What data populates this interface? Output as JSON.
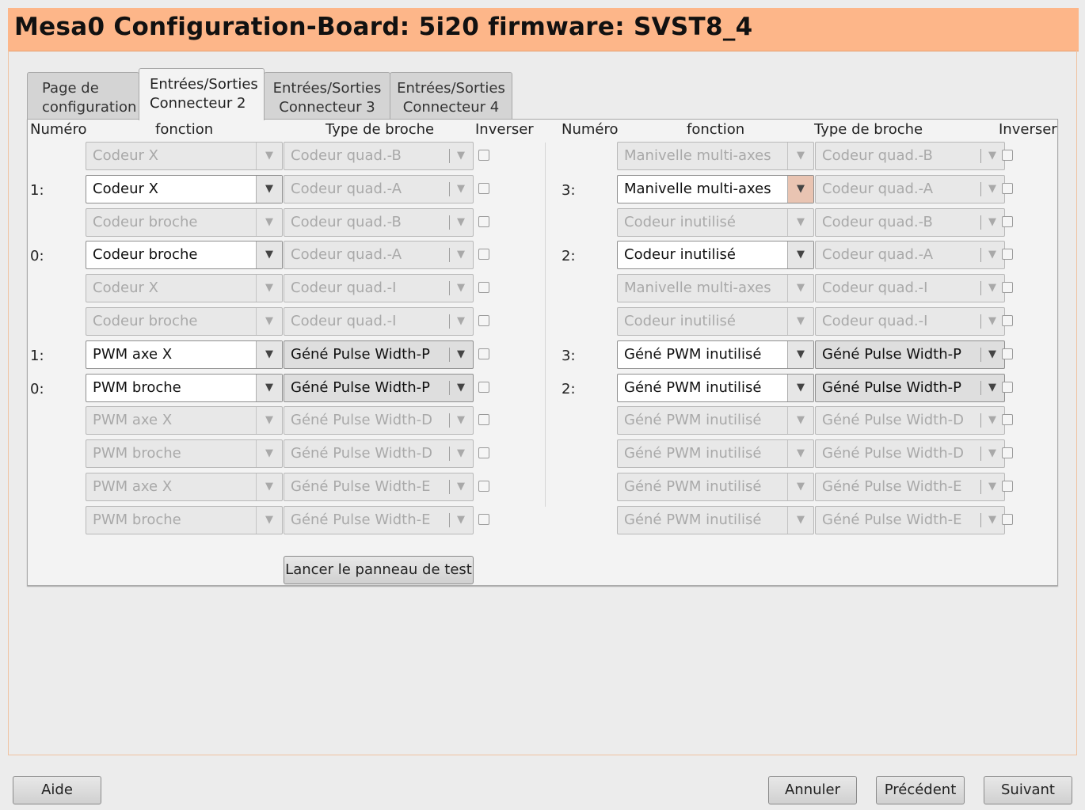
{
  "window": {
    "title": "Mesa0 Configuration-Board: 5i20 firmware: SVST8_4"
  },
  "tabs": [
    {
      "line1": "Page de",
      "line2": "configuration"
    },
    {
      "line1": "Entrées/Sorties",
      "line2": "Connecteur 2"
    },
    {
      "line1": "Entrées/Sorties",
      "line2": "Connecteur 3"
    },
    {
      "line1": "Entrées/Sorties",
      "line2": "Connecteur 4"
    }
  ],
  "headers": {
    "numero": "Numéro",
    "fonction": "fonction",
    "type": "Type de broche",
    "inverser": "Inverser"
  },
  "left_rows": [
    {
      "num": "",
      "fn": "Codeur X",
      "type": "Codeur quad.-B"
    },
    {
      "num": "1:",
      "fn": "Codeur X",
      "type": "Codeur quad.-A"
    },
    {
      "num": "",
      "fn": "Codeur broche",
      "type": "Codeur quad.-B"
    },
    {
      "num": "0:",
      "fn": "Codeur broche",
      "type": "Codeur quad.-A"
    },
    {
      "num": "",
      "fn": "Codeur X",
      "type": "Codeur quad.-I"
    },
    {
      "num": "",
      "fn": "Codeur broche",
      "type": "Codeur quad.-I"
    },
    {
      "num": "1:",
      "fn": "PWM axe X",
      "type": "Géné Pulse Width-P"
    },
    {
      "num": "0:",
      "fn": "PWM broche",
      "type": "Géné Pulse Width-P"
    },
    {
      "num": "",
      "fn": "PWM axe X",
      "type": "Géné Pulse Width-D"
    },
    {
      "num": "",
      "fn": "PWM broche",
      "type": "Géné Pulse Width-D"
    },
    {
      "num": "",
      "fn": "PWM axe X",
      "type": "Géné Pulse Width-E"
    },
    {
      "num": "",
      "fn": "PWM broche",
      "type": "Géné Pulse Width-E"
    }
  ],
  "right_rows": [
    {
      "num": "",
      "fn": "Manivelle multi-axes",
      "type": "Codeur quad.-B"
    },
    {
      "num": "3:",
      "fn": "Manivelle multi-axes",
      "type": "Codeur quad.-A"
    },
    {
      "num": "",
      "fn": "Codeur inutilisé",
      "type": "Codeur quad.-B"
    },
    {
      "num": "2:",
      "fn": "Codeur inutilisé",
      "type": "Codeur quad.-A"
    },
    {
      "num": "",
      "fn": "Manivelle multi-axes",
      "type": "Codeur quad.-I"
    },
    {
      "num": "",
      "fn": "Codeur inutilisé",
      "type": "Codeur quad.-I"
    },
    {
      "num": "3:",
      "fn": "Géné PWM inutilisé",
      "type": "Géné Pulse Width-P"
    },
    {
      "num": "2:",
      "fn": "Géné PWM inutilisé",
      "type": "Géné Pulse Width-P"
    },
    {
      "num": "",
      "fn": "Géné PWM inutilisé",
      "type": "Géné Pulse Width-D"
    },
    {
      "num": "",
      "fn": "Géné PWM inutilisé",
      "type": "Géné Pulse Width-D"
    },
    {
      "num": "",
      "fn": "Géné PWM inutilisé",
      "type": "Géné Pulse Width-E"
    },
    {
      "num": "",
      "fn": "Géné PWM inutilisé",
      "type": "Géné Pulse Width-E"
    }
  ],
  "test_button": "Lancer le panneau de test",
  "footer": {
    "help": "Aide",
    "cancel": "Annuler",
    "previous": "Précédent",
    "next": "Suivant"
  }
}
